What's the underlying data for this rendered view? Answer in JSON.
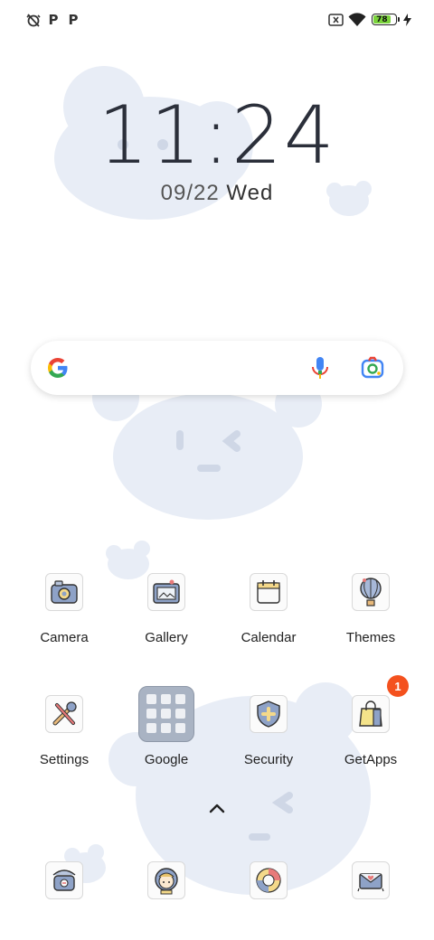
{
  "status_bar": {
    "left_icons": [
      "muted-alarm-icon",
      "p-notification-icon",
      "p-notification-icon"
    ],
    "p_glyph": "P",
    "right_icons": [
      "no-sim-icon",
      "wifi-icon",
      "battery-icon",
      "charging-icon"
    ],
    "battery_level": "78"
  },
  "clock": {
    "time": "11:24",
    "date": "09/22",
    "day": "Wed"
  },
  "search_bar": {
    "icons": [
      "google-logo-icon",
      "microphone-icon",
      "google-lens-icon"
    ]
  },
  "apps": [
    {
      "label": "Camera",
      "icon": "camera-icon"
    },
    {
      "label": "Gallery",
      "icon": "gallery-icon"
    },
    {
      "label": "Calendar",
      "icon": "calendar-icon"
    },
    {
      "label": "Themes",
      "icon": "themes-balloon-icon"
    },
    {
      "label": "Settings",
      "icon": "settings-tools-icon"
    },
    {
      "label": "Google",
      "icon": "google-folder-icon"
    },
    {
      "label": "Security",
      "icon": "security-shield-icon"
    },
    {
      "label": "GetApps",
      "icon": "getapps-bag-icon",
      "badge": "1"
    }
  ],
  "dock": [
    "phone-icon",
    "messaging-avatar-icon",
    "browser-icon",
    "mail-icon"
  ],
  "drawer_hint": "chevron-up-icon",
  "colors": {
    "wallpaper_blob": "#e6ecf5",
    "badge": "#f4511e",
    "battery": "#7ad33b"
  }
}
